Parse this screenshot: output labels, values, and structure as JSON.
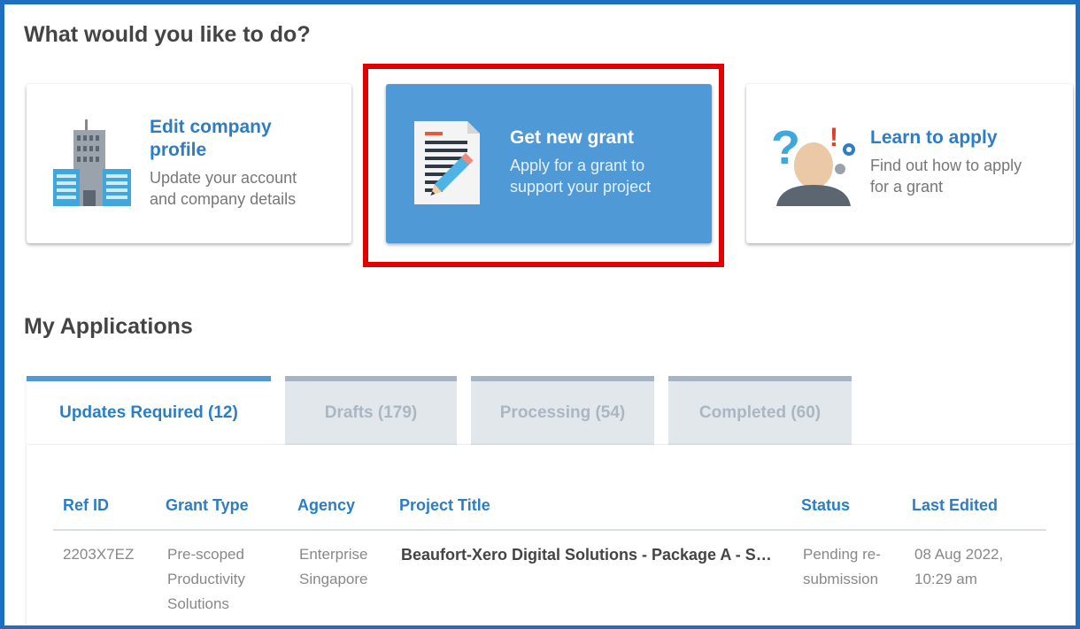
{
  "heading": "What would you like to do?",
  "cards": [
    {
      "title": "Edit company profile",
      "title_line1": "Edit company",
      "title_line2": "profile",
      "desc_line1": "Update your account",
      "desc_line2": "and company details",
      "icon": "building-icon"
    },
    {
      "title": "Get new grant",
      "desc_line1": "Apply for a grant to",
      "desc_line2": "support your project",
      "icon": "document-pencil-icon"
    },
    {
      "title": "Learn to apply",
      "desc_line1": "Find out how to apply",
      "desc_line2": "for a grant",
      "icon": "person-question-icon"
    }
  ],
  "applications": {
    "heading": "My Applications",
    "tabs": [
      {
        "label": "Updates Required (12)",
        "active": true
      },
      {
        "label": "Drafts (179)",
        "active": false
      },
      {
        "label": "Processing (54)",
        "active": false
      },
      {
        "label": "Completed (60)",
        "active": false
      }
    ],
    "columns": [
      "Ref ID",
      "Grant Type",
      "Agency",
      "Project Title",
      "Status",
      "Last Edited"
    ],
    "rows": [
      {
        "ref_id": "2203X7EZ",
        "grant_type": [
          "Pre-scoped",
          "Productivity",
          "Solutions"
        ],
        "agency": [
          "Enterprise",
          "Singapore"
        ],
        "project_title": "Beaufort-Xero Digital Solutions - Package A - S…",
        "status": [
          "Pending re-",
          "submission"
        ],
        "last_edited": [
          "08 Aug 2022,",
          "10:29 am"
        ]
      }
    ]
  },
  "colors": {
    "frame": "#1f6fc1",
    "accent": "#2c7ec4",
    "primary_card": "#4f9ad6",
    "highlight": "#e30000"
  }
}
